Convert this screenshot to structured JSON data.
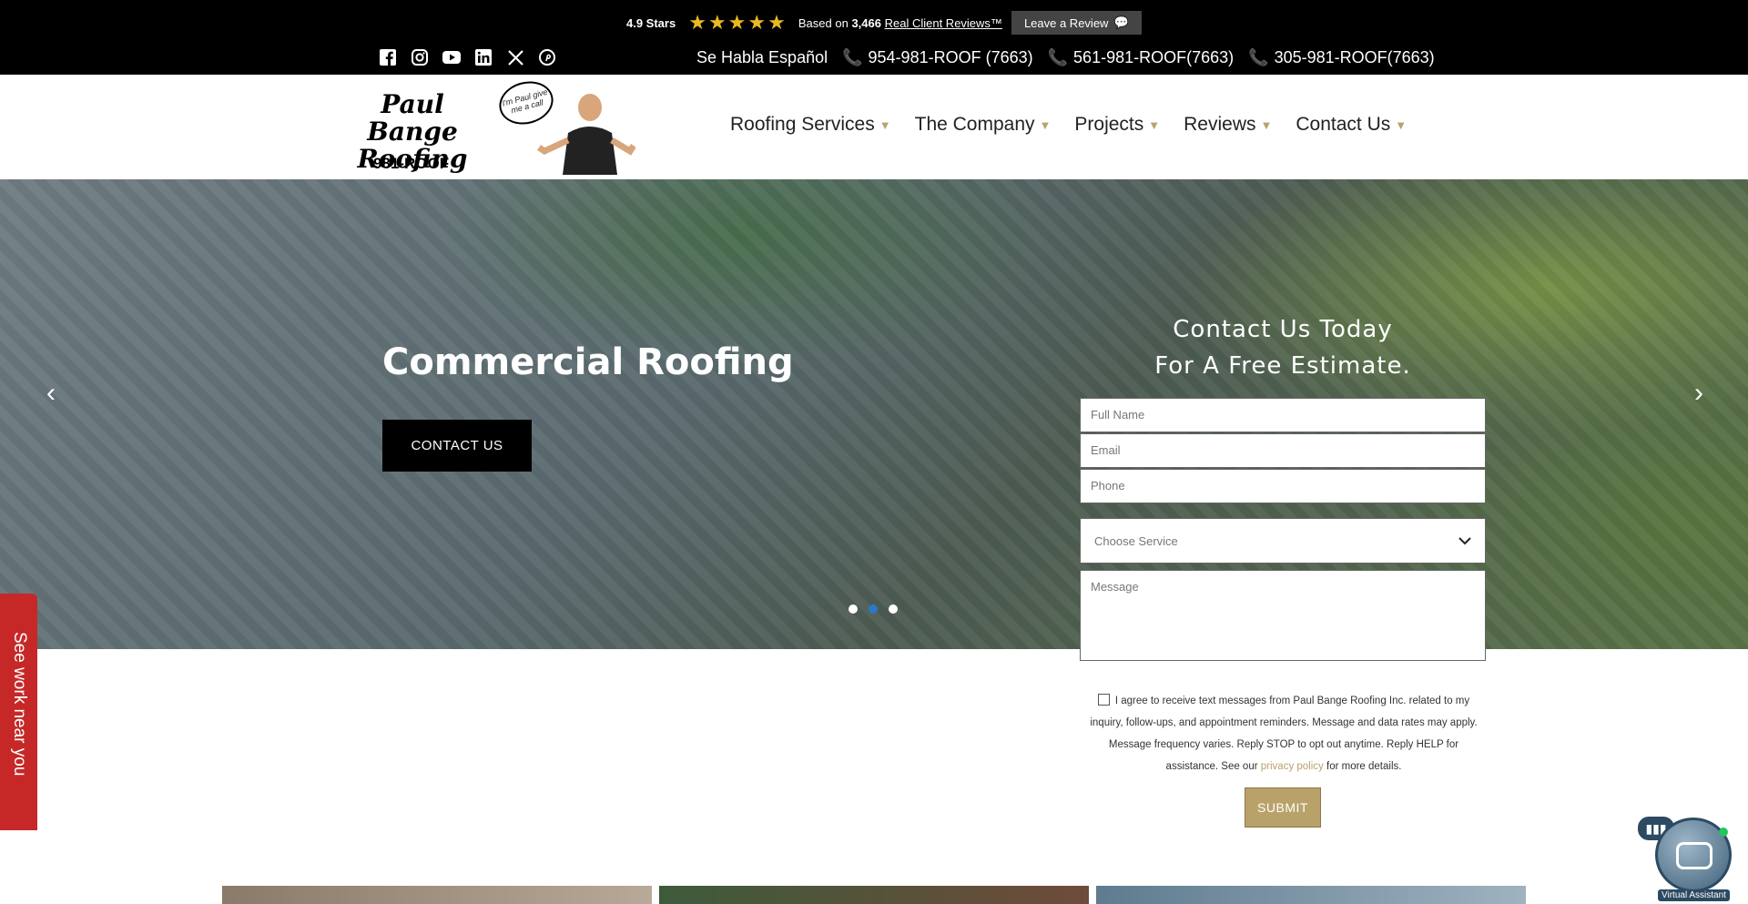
{
  "review_bar": {
    "rating": "4.9 Stars",
    "stars": [
      "★",
      "★",
      "★",
      "★",
      "★"
    ],
    "based_on_prefix": "Based on",
    "review_count": "3,466",
    "based_on_suffix": "Real Client Reviews™",
    "leave_review_label": "Leave a Review"
  },
  "social_icons": [
    "facebook-icon",
    "instagram-icon",
    "youtube-icon",
    "linkedin-icon",
    "x-icon",
    "pinterest-icon"
  ],
  "contact_bar": {
    "spanish": "Se Habla Español",
    "phones": [
      "954-981-ROOF (7663)",
      "561-981-ROOF(7663)",
      "305-981-ROOF(7663)"
    ]
  },
  "logo": {
    "line1": "Paul Bange",
    "line2": "Roofing",
    "number": "981-ROOF",
    "bubble": "I'm Paul give me a call"
  },
  "nav": {
    "items": [
      "Roofing Services",
      "The Company",
      "Projects",
      "Reviews",
      "Contact Us"
    ]
  },
  "hero": {
    "title": "Commercial Roofing",
    "button": "CONTACT US",
    "prev": "‹",
    "next": "›",
    "slide_count": 3,
    "active_slide": 2
  },
  "form": {
    "title_line1": "Contact Us Today",
    "title_line2": "For A Free Estimate.",
    "full_name_placeholder": "Full Name",
    "email_placeholder": "Email",
    "phone_placeholder": "Phone",
    "service_placeholder": "Choose Service",
    "message_placeholder": "Message",
    "consent_text": "I agree to receive text messages from Paul Bange Roofing Inc. related to my inquiry, follow-ups, and appointment reminders. Message and data rates may apply. Message frequency varies. Reply STOP to opt out anytime. Reply HELP for assistance. See our",
    "privacy_link": "privacy policy",
    "consent_suffix": "for more details.",
    "submit": "SUBMIT"
  },
  "side_tab": "See work near you",
  "assistant": {
    "label": "Virtual Assistant"
  },
  "colors": {
    "accent_gold": "#b9a26a",
    "side_tab_red": "#c62828",
    "active_dot_blue": "#2979c9"
  }
}
